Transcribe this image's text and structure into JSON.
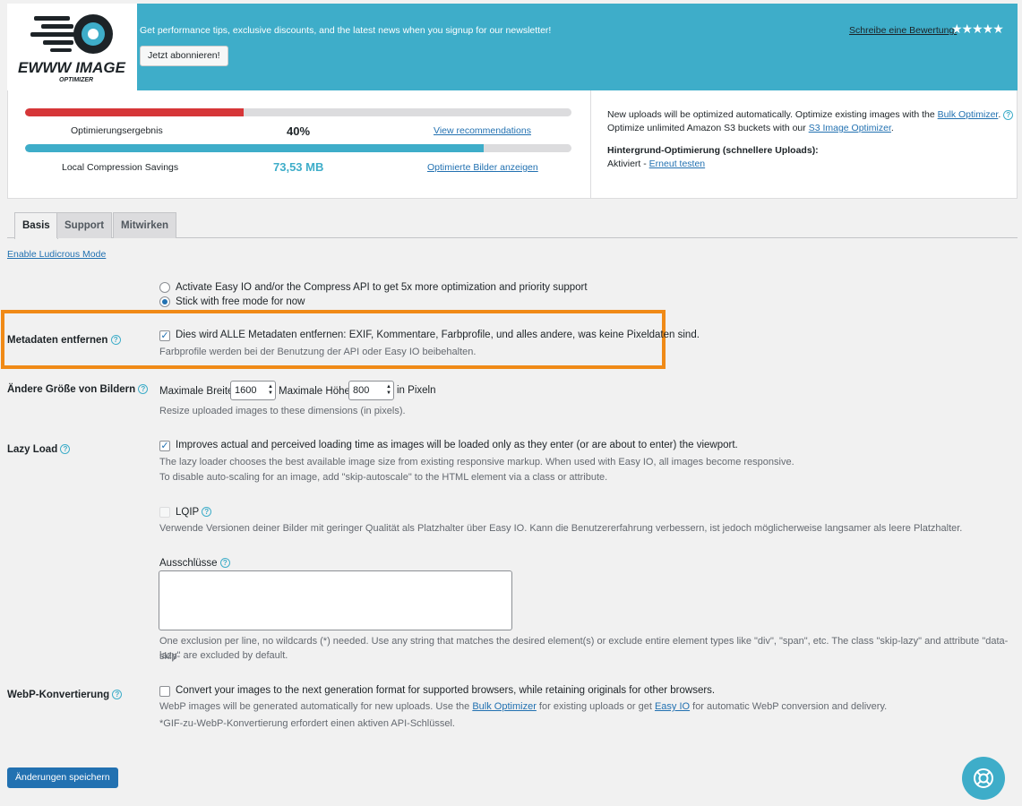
{
  "banner": {
    "newsletter_text": "Get performance tips, exclusive discounts, and the latest news when you signup for our newsletter!",
    "subscribe_label": "Jetzt abonnieren!",
    "review_link": "Schreibe eine Bewertung.",
    "stars": "★★★★★",
    "logo_text": "EWWW IMAGE",
    "logo_subtext": "OPTIMIZER"
  },
  "stats": {
    "optimization": {
      "label": "Optimierungsergebnis",
      "value": "40%",
      "progress": 0.4,
      "link": "View recommendations",
      "bar_color": "#d63638"
    },
    "savings": {
      "label": "Local Compression Savings",
      "value": "73,53 MB",
      "progress": 0.84,
      "link": "Optimierte Bilder anzeigen",
      "bar_color": "#3eadc9"
    },
    "right_line1_pre": "New uploads will be optimized automatically. Optimize existing images with the ",
    "right_line1_link": "Bulk Optimizer",
    "right_line1_post": ".",
    "right_line2_pre": "Optimize unlimited Amazon S3 buckets with our ",
    "right_line2_link": "S3 Image Optimizer",
    "right_line2_post": ".",
    "bg_title": "Hintergrund-Optimierung (schnellere Uploads):",
    "bg_status": "Aktiviert - ",
    "bg_link": "Erneut testen"
  },
  "tabs": [
    "Basis",
    "Support",
    "Mitwirken"
  ],
  "ludicrous_link": "Enable Ludicrous Mode",
  "mode": {
    "option1": "Activate Easy IO and/or the Compress API to get 5x more optimization and priority support",
    "option2": "Stick with free mode for now",
    "selected": "option2"
  },
  "metadata": {
    "label": "Metadaten entfernen",
    "checkbox_text": "Dies wird ALLE Metadaten entfernen: EXIF, Kommentare, Farbprofile, und alles andere, was keine Pixeldaten sind.",
    "desc": "Farbprofile werden bei der Benutzung der API oder Easy IO beibehalten.",
    "checked": true
  },
  "resize": {
    "label": "Ändere Größe von Bildern",
    "width_label": "Maximale Breite",
    "width_value": "1600",
    "height_label": "Maximale Höhe",
    "height_value": "800",
    "unit": "in Pixeln",
    "desc": "Resize uploaded images to these dimensions (in pixels)."
  },
  "lazyload": {
    "label": "Lazy Load",
    "checkbox_text": "Improves actual and perceived loading time as images will be loaded only as they enter (or are about to enter) the viewport.",
    "desc1": "The lazy loader chooses the best available image size from existing responsive markup. When used with Easy IO, all images become responsive.",
    "desc2": "To disable auto-scaling for an image, add \"skip-autoscale\" to the HTML element via a class or attribute.",
    "checked": true,
    "lqip_label": "LQIP",
    "lqip_desc": "Verwende Versionen deiner Bilder mit geringer Qualität als Platzhalter über Easy IO. Kann die Benutzererfahrung verbessern, ist jedoch möglicherweise langsamer als leere Platzhalter.",
    "exclusions_label": "Ausschlüsse",
    "exclusions_value": "",
    "exclusions_desc1": "One exclusion per line, no wildcards (*) needed. Use any string that matches the desired element(s) or exclude entire element types like \"div\", \"span\", etc. The class \"skip-lazy\" and attribute \"data-skip-",
    "exclusions_desc2": "lazy\" are excluded by default."
  },
  "webp": {
    "label": "WebP-Konvertierung",
    "checkbox_text": "Convert your images to the next generation format for supported browsers, while retaining originals for other browsers.",
    "desc_pre": "WebP images will be generated automatically for new uploads. Use the ",
    "desc_link1": "Bulk Optimizer",
    "desc_mid": " for existing uploads or get ",
    "desc_link2": "Easy IO",
    "desc_post": " for automatic WebP conversion and delivery.",
    "note": "*GIF-zu-WebP-Konvertierung erfordert einen aktiven API-Schlüssel.",
    "checked": false
  },
  "save_label": "Änderungen speichern",
  "colors": {
    "accent": "#3eadc9",
    "highlight": "#f08a17",
    "primary": "#2271b1"
  }
}
